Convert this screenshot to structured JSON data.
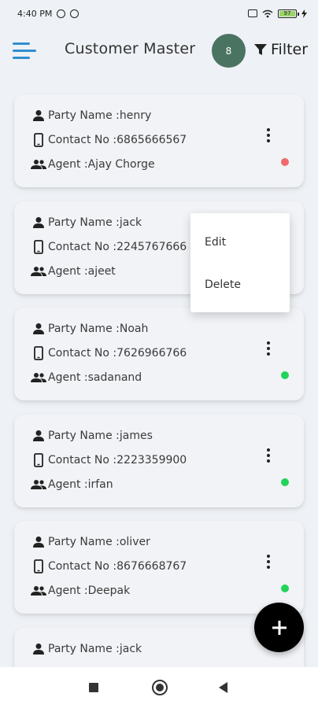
{
  "status_bar": {
    "time": "4:40 PM",
    "battery": "97"
  },
  "app_bar": {
    "title": "Customer Master",
    "badge_count": "8",
    "filter_label": "Filter",
    "menu_icon": "hamburger-menu-icon",
    "filter_icon": "funnel-icon"
  },
  "labels": {
    "party": "Party Name : ",
    "contact": "Contact No : ",
    "agent": "Agent : "
  },
  "customers": [
    {
      "party": "henry",
      "contact": "6865666567",
      "agent": "Ajay Chorge",
      "status_color": "#ef6b6b"
    },
    {
      "party": "jack",
      "contact": "2245767666",
      "agent": "ajeet",
      "status_color": ""
    },
    {
      "party": "Noah",
      "contact": "7626966766",
      "agent": "sadanand",
      "status_color": "#22d35a"
    },
    {
      "party": "james",
      "contact": "2223359900",
      "agent": "irfan",
      "status_color": "#22d35a"
    },
    {
      "party": "oliver",
      "contact": "8676668767",
      "agent": "Deepak",
      "status_color": "#22d35a"
    },
    {
      "party": "jack",
      "contact": "",
      "agent": "",
      "status_color": ""
    }
  ],
  "popup_menu": {
    "items": [
      "Edit",
      "Delete"
    ]
  },
  "fab": {
    "icon": "plus-icon"
  },
  "colors": {
    "accent": "#2f8fd0",
    "badge_bg": "#4b7361",
    "active": "#22d35a",
    "inactive": "#ef6b6b"
  }
}
